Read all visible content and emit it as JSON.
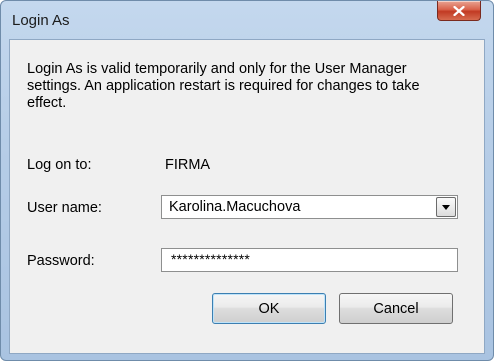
{
  "window": {
    "title": "Login As",
    "close_icon": "close-icon"
  },
  "message": "Login As is valid temporarily and only for the User Manager settings.  An application restart is required for changes to take effect.",
  "logon": {
    "label": "Log on to:",
    "value": "FIRMA"
  },
  "username": {
    "label": "User name:",
    "value": "Karolina.Macuchova",
    "dropdown_icon": "chevron-down-icon"
  },
  "password": {
    "label": "Password:",
    "masked_value": "**************"
  },
  "buttons": {
    "ok": "OK",
    "cancel": "Cancel"
  },
  "colors": {
    "frame": "#b6cde7",
    "close_button": "#c9442b",
    "client_bg": "#f0f0f0"
  }
}
